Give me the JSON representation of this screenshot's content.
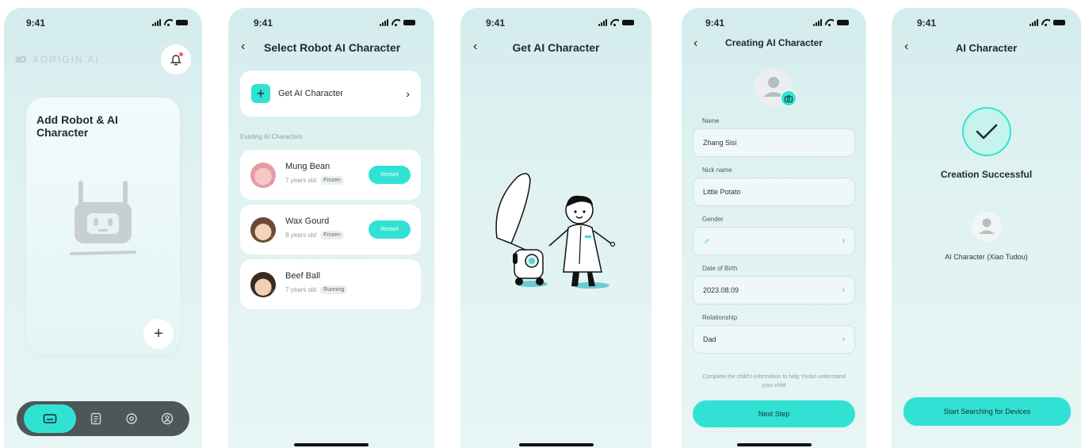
{
  "time": "9:41",
  "screen1": {
    "brand": "XORIGIN AI",
    "card_title": "Add Robot & AI Character",
    "tabs": [
      "robot-icon",
      "notes-icon",
      "camera-scan-icon",
      "profile-icon"
    ]
  },
  "screen2": {
    "title": "Select Robot AI Character",
    "get_label": "Get AI Character",
    "section_label": "Existing AI Characters",
    "characters": [
      {
        "name": "Mung Bean",
        "age": "7 years old",
        "status": "Frozen",
        "gender": "♀",
        "action": "Restart"
      },
      {
        "name": "Wax Gourd",
        "age": "8 years old",
        "status": "Frozen",
        "gender": "♀",
        "action": "Restart"
      },
      {
        "name": "Beef Ball",
        "age": "7 years old",
        "status": "Running",
        "gender": "♂"
      }
    ]
  },
  "screen3": {
    "title": "Get AI Character"
  },
  "screen4": {
    "title": "Creating AI Character",
    "fields": [
      {
        "label": "Name",
        "value": "Zhang Sisi"
      },
      {
        "label": "Nick name",
        "value": "Little Potato"
      },
      {
        "label": "Gender",
        "value": "♂"
      },
      {
        "label": "Date of Birth",
        "value": "2023.08.09"
      },
      {
        "label": "Relationship",
        "value": "Dad"
      }
    ],
    "hint": "Complete the child's information to help Yonbo understand your child",
    "button": "Next Step"
  },
  "screen5": {
    "title": "AI Character",
    "success": "Creation Successful",
    "character_caption": "AI Character (Xiao Tudou)",
    "button": "Start Searching for Devices"
  },
  "colors": {
    "accent": "#31e2d4",
    "background": "#def1f1",
    "tabbar": "#4e5658"
  }
}
